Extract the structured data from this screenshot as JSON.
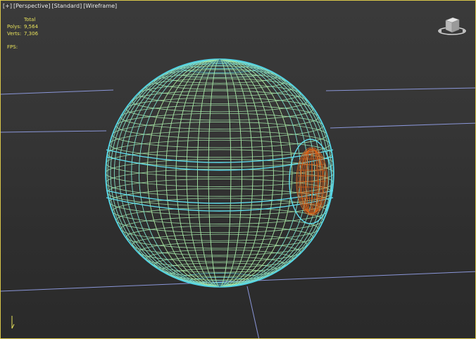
{
  "viewport": {
    "label": {
      "plus": "+",
      "view": "Perspective",
      "shading_style": "Standard",
      "display_mode": "Wireframe"
    },
    "stats": {
      "header": "Total",
      "polys_label": "Polys:",
      "polys_value": "9,564",
      "verts_label": "Verts:",
      "verts_value": "7,306",
      "fps_label": "FPS:"
    }
  },
  "colors": {
    "viewport_border": "#d9c64a",
    "wire_cyan": "#4fd4e8",
    "wire_green": "#a8e6a0",
    "wire_yellow": "#e8d050",
    "wire_orange": "#d8621a",
    "grid_line": "#8a96d8",
    "stats_text": "#e6e05a"
  },
  "icons": {
    "viewcube": "viewcube-icon",
    "axis_tripod": "axis-tripod-icon"
  }
}
